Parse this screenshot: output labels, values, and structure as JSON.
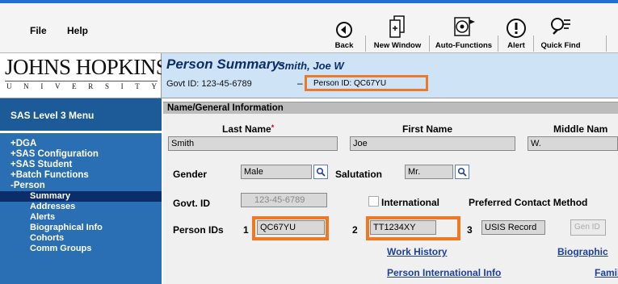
{
  "menubar": {
    "file": "File",
    "help": "Help"
  },
  "toolbar": {
    "back": "Back",
    "new_window": "New Window",
    "auto_functions": "Auto-Functions",
    "alert": "Alert",
    "quick_find": "Quick Find"
  },
  "logo": {
    "name": "JOHNS HOPKINS",
    "university_letters": [
      "U",
      "N",
      "I",
      "V",
      "E",
      "R",
      "S",
      "I",
      "T",
      "Y"
    ]
  },
  "header": {
    "title": "Person Summary-",
    "person_name": "Smith, Joe W",
    "govt_id": "Govt ID: 123-45-6789",
    "dash": "–",
    "person_id": "Person ID:  QC67YU"
  },
  "sidebar": {
    "level": "SAS Level 3 Menu",
    "items": [
      {
        "label": "+DGA",
        "type": "top"
      },
      {
        "label": "+SAS Configuration",
        "type": "top"
      },
      {
        "label": "+SAS Student",
        "type": "top"
      },
      {
        "label": "+Batch Functions",
        "type": "top"
      },
      {
        "label": "-Person",
        "type": "top"
      },
      {
        "label": "Summary",
        "type": "sub",
        "active": true
      },
      {
        "label": "Addresses",
        "type": "sub"
      },
      {
        "label": "Alerts",
        "type": "sub"
      },
      {
        "label": "Biographical Info",
        "type": "sub"
      },
      {
        "label": "Cohorts",
        "type": "sub"
      },
      {
        "label": "Comm Groups",
        "type": "sub"
      }
    ]
  },
  "section": {
    "title": "Name/General Information",
    "last_name_label": "Last Name",
    "required_mark": "*",
    "first_name_label": "First Name",
    "middle_name_label": "Middle Nam",
    "last_name": "Smith",
    "first_name": "Joe",
    "middle_name": "W.",
    "gender_label": "Gender",
    "gender": "Male",
    "salutation_label": "Salutation",
    "salutation": "Mr.",
    "govt_id_label": "Govt. ID",
    "govt_id": "123-45-6789",
    "international_label": "International",
    "preferred_contact_label": "Preferred Contact Method",
    "person_ids_label": "Person IDs",
    "pid_num_1": "1",
    "pid_1": "QC67YU",
    "pid_num_2": "2",
    "pid_2": "TT1234XY",
    "pid_num_3": "3",
    "pid_3": "USIS Record",
    "gen_id_button": "Gen ID",
    "links": {
      "work_history": "Work History",
      "biographical": "Biographic",
      "person_international": "Person International Info",
      "family": "Famil"
    }
  },
  "colors": {
    "highlight": "#f07822",
    "sidebar_bg": "#2a6fb3",
    "sidebar_active": "#0b2e6b",
    "header_bg": "#cfe3f7"
  }
}
